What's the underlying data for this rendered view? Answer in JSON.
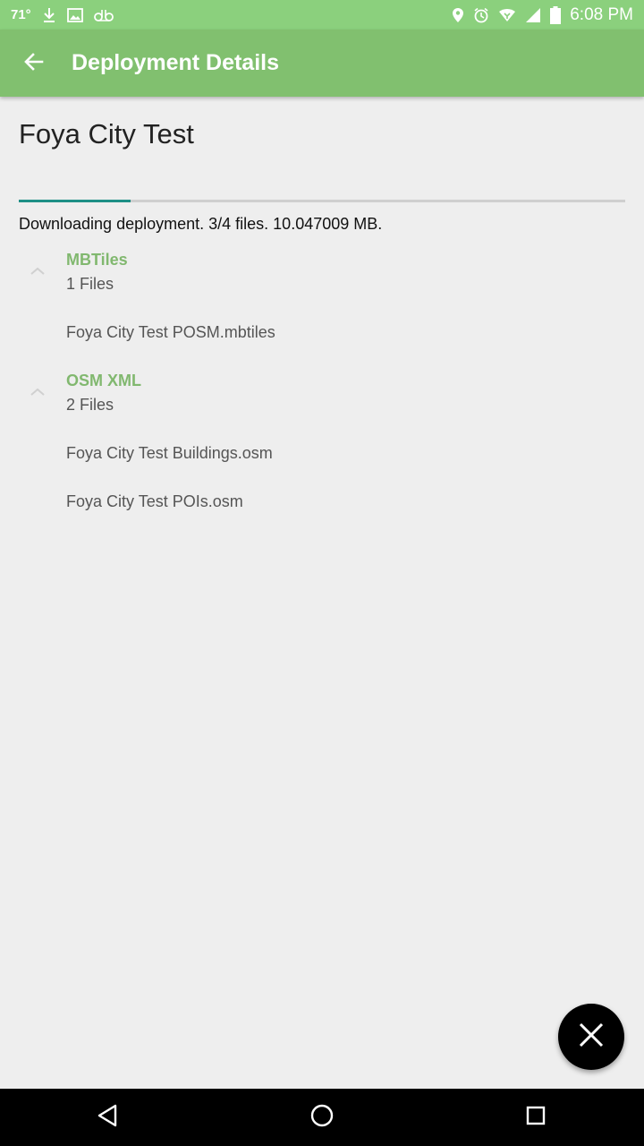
{
  "status_bar": {
    "temperature": "71°",
    "time": "6:08 PM",
    "left_icons": [
      "download-icon",
      "image-icon",
      "voicemail-icon"
    ],
    "right_icons": [
      "location-icon",
      "alarm-icon",
      "wifi-icon",
      "signal-icon",
      "battery-icon"
    ]
  },
  "app_bar": {
    "title": "Deployment Details",
    "back_icon": "arrow-back-icon",
    "color": "#81c06f"
  },
  "deployment": {
    "name": "Foya City Test",
    "progress_fraction": 0.185,
    "progress_color": "#1e8f86",
    "status": "Downloading deployment. 3/4 files. 10.047009 MB."
  },
  "groups": [
    {
      "name": "MBTiles",
      "count": "1 Files",
      "files": [
        "Foya City Test POSM.mbtiles"
      ]
    },
    {
      "name": "OSM XML",
      "count": "2 Files",
      "files": [
        "Foya City Test Buildings.osm",
        "Foya City Test POIs.osm"
      ]
    }
  ],
  "fab": {
    "icon": "close-icon"
  },
  "nav_bar": {
    "icons": [
      "nav-back-icon",
      "nav-home-icon",
      "nav-recents-icon"
    ]
  }
}
